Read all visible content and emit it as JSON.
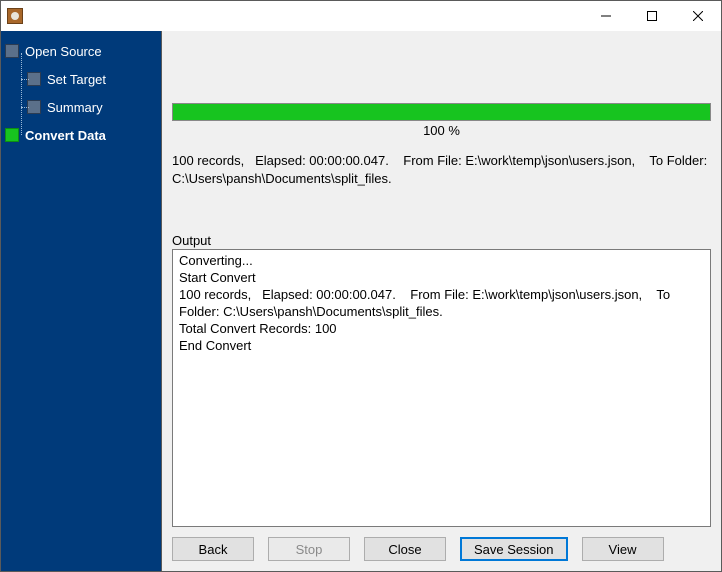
{
  "titlebar": {
    "title": ""
  },
  "sidebar": {
    "items": [
      {
        "label": "Open Source",
        "active": false,
        "child": false
      },
      {
        "label": "Set Target",
        "active": false,
        "child": true
      },
      {
        "label": "Summary",
        "active": false,
        "child": true
      },
      {
        "label": "Convert Data",
        "active": true,
        "child": false
      }
    ]
  },
  "progress": {
    "percent_label": "100 %",
    "fill_percent": 100
  },
  "summary_text": "100 records,   Elapsed: 00:00:00.047.    From File: E:\\work\\temp\\json\\users.json,    To Folder: C:\\Users\\pansh\\Documents\\split_files.",
  "output": {
    "label": "Output",
    "text": "Converting...\nStart Convert\n100 records,   Elapsed: 00:00:00.047.    From File: E:\\work\\temp\\json\\users.json,    To Folder: C:\\Users\\pansh\\Documents\\split_files.\nTotal Convert Records: 100\nEnd Convert"
  },
  "buttons": {
    "back": "Back",
    "stop": "Stop",
    "close": "Close",
    "save_session": "Save Session",
    "view": "View"
  },
  "colors": {
    "sidebar_bg": "#003a7a",
    "progress_fill": "#17c41f",
    "primary_border": "#0078d7"
  }
}
